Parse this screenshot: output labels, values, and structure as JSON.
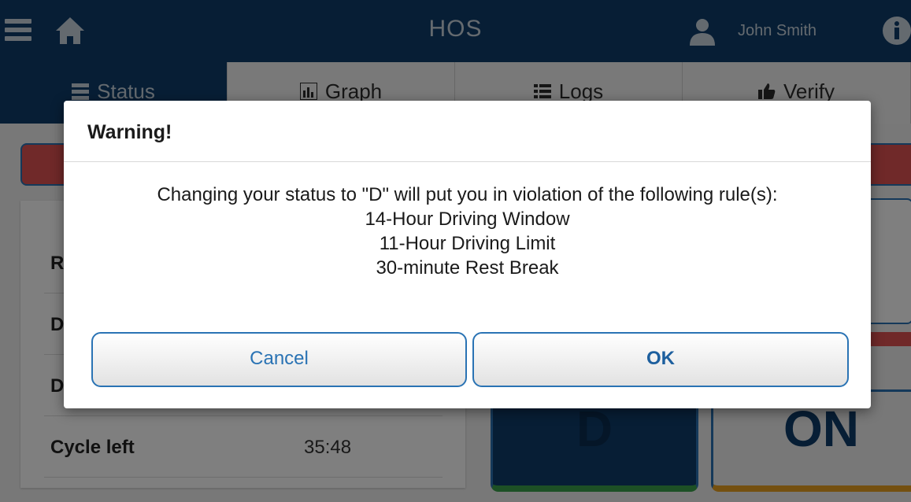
{
  "header": {
    "title": "HOS",
    "user_name": "John Smith",
    "icons": [
      "menu-icon",
      "home-icon",
      "user-icon",
      "info-icon"
    ]
  },
  "tabs": [
    {
      "label": "Status",
      "icon": "status-icon",
      "active": true
    },
    {
      "label": "Graph",
      "icon": "graph-icon",
      "active": false
    },
    {
      "label": "Logs",
      "icon": "list-icon",
      "active": false
    },
    {
      "label": "Verify",
      "icon": "thumbs-up-icon",
      "active": false
    }
  ],
  "background": {
    "rows": [
      {
        "label": "R",
        "value": ""
      },
      {
        "label": "D",
        "value": ""
      },
      {
        "label": "D",
        "value": ""
      },
      {
        "label": "Cycle left",
        "value": "35:48"
      }
    ],
    "status_tiles": [
      {
        "label": "D"
      },
      {
        "label": "ON"
      }
    ]
  },
  "dialog": {
    "title": "Warning!",
    "message": "Changing your status to \"D\" will put you in violation of the following rule(s):",
    "rules": [
      "14-Hour Driving Window",
      "11-Hour Driving Limit",
      "30-minute Rest Break"
    ],
    "cancel_label": "Cancel",
    "ok_label": "OK"
  },
  "colors": {
    "brand_navy": "#0e3c6a",
    "accent_blue": "#2a73b4",
    "alert_red": "#e05252"
  }
}
